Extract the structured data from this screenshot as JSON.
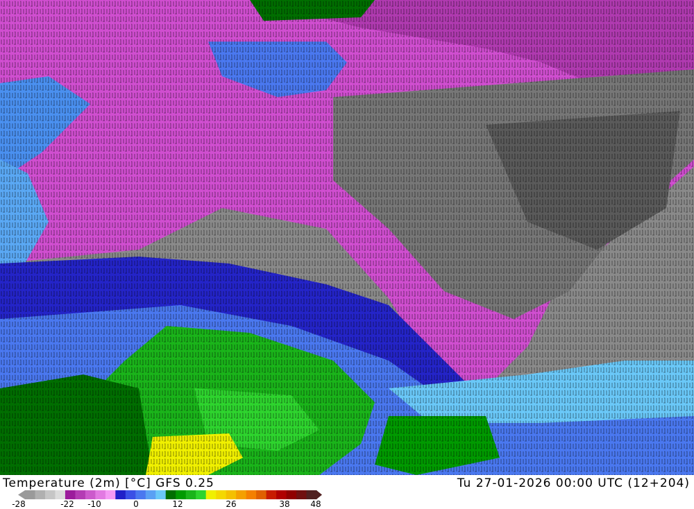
{
  "title": {
    "product": "Temperature (2m) [°C] GFS 0.25",
    "valid_time": "Tu 27-01-2026 00:00 UTC (12+204)"
  },
  "legend": {
    "ticks": [
      "-28",
      "-22",
      "-10",
      "0",
      "12",
      "26",
      "38",
      "48"
    ],
    "colors": [
      "#9a9a9a",
      "#b0b0b0",
      "#c6c6c6",
      "#dcdcdc",
      "#9c1c9c",
      "#b43cb4",
      "#cc5acc",
      "#e27ae2",
      "#f49af4",
      "#2020c8",
      "#3a50e6",
      "#4a78f0",
      "#5aa0f4",
      "#6ac8f8",
      "#006e00",
      "#009a00",
      "#1ab41a",
      "#2ed42e",
      "#f0f000",
      "#f4d800",
      "#f4c000",
      "#f4a000",
      "#f48000",
      "#e06000",
      "#c81c00",
      "#b00000",
      "#900000",
      "#701010",
      "#502020"
    ]
  }
}
